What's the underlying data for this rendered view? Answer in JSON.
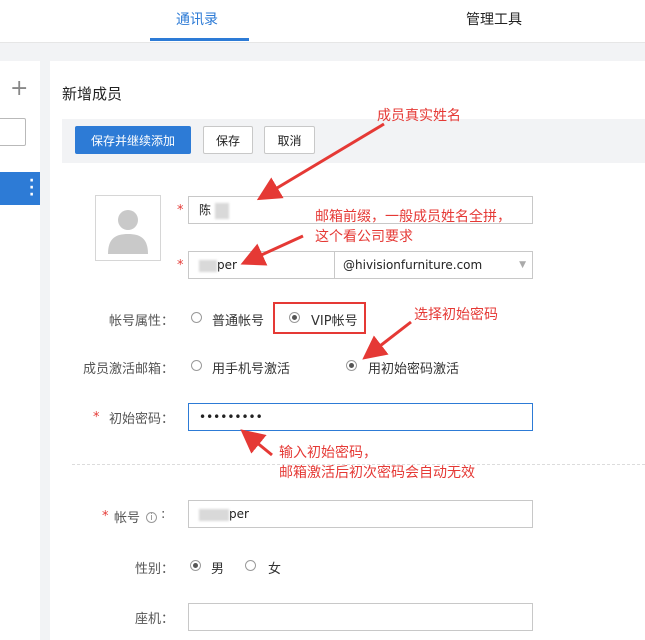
{
  "tabs": [
    {
      "label": "通讯录",
      "active": true
    },
    {
      "label": "管理工具",
      "active": false
    }
  ],
  "page": {
    "title": "新增成员"
  },
  "toolbar": {
    "save_continue": "保存并继续添加",
    "save": "保存",
    "cancel": "取消"
  },
  "form": {
    "name_value": "陈",
    "email_prefix_value": "per",
    "email_domain": "@hivisionfurniture.com",
    "account_type_label": "帐号属性：",
    "account_type_options": [
      "普通帐号",
      "VIP帐号"
    ],
    "account_type_selected": "VIP帐号",
    "activation_label": "成员激活邮箱：",
    "activation_options": [
      "用手机号激活",
      "用初始密码激活"
    ],
    "activation_selected": "用初始密码激活",
    "password_label": "初始密码：",
    "password_value": "•••••••••",
    "account_label": "帐号",
    "account_value": "per",
    "gender_label": "性别：",
    "gender_options": [
      "男",
      "女"
    ],
    "gender_selected": "男",
    "phone_label": "座机：",
    "phone_value": ""
  },
  "annotations": {
    "name_note": "成员真实姓名",
    "email_note_line1": "邮箱前缀，一般成员姓名全拼，",
    "email_note_line2": "这个看公司要求",
    "password_select_note": "选择初始密码",
    "password_input_note_line1": "输入初始密码，",
    "password_input_note_line2": "邮箱激活后初次密码会自动无效"
  },
  "colors": {
    "accent": "#2d7bd6",
    "annotation_red": "#e53935"
  }
}
